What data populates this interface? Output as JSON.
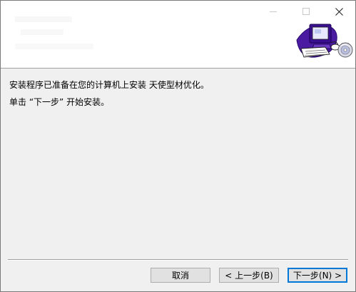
{
  "window": {
    "minimize_icon": "minimize-icon",
    "maximize_icon": "maximize-icon",
    "close_icon": "close-icon"
  },
  "header": {
    "icon": "computer-setup-icon"
  },
  "content": {
    "line1": "安装程序已准备在您的计算机上安装 天使型材优化。",
    "line2": "单击 “下一步” 开始安装。"
  },
  "buttons": {
    "cancel": "取消",
    "back": "< 上一步(B)",
    "next": "下一步(N) >"
  },
  "colors": {
    "header_bg": "#ffffff",
    "body_bg": "#f0f0f0",
    "button_bg": "#e1e1e1",
    "default_border": "#0078d7",
    "monitor_purple": "#4a1aa0"
  }
}
